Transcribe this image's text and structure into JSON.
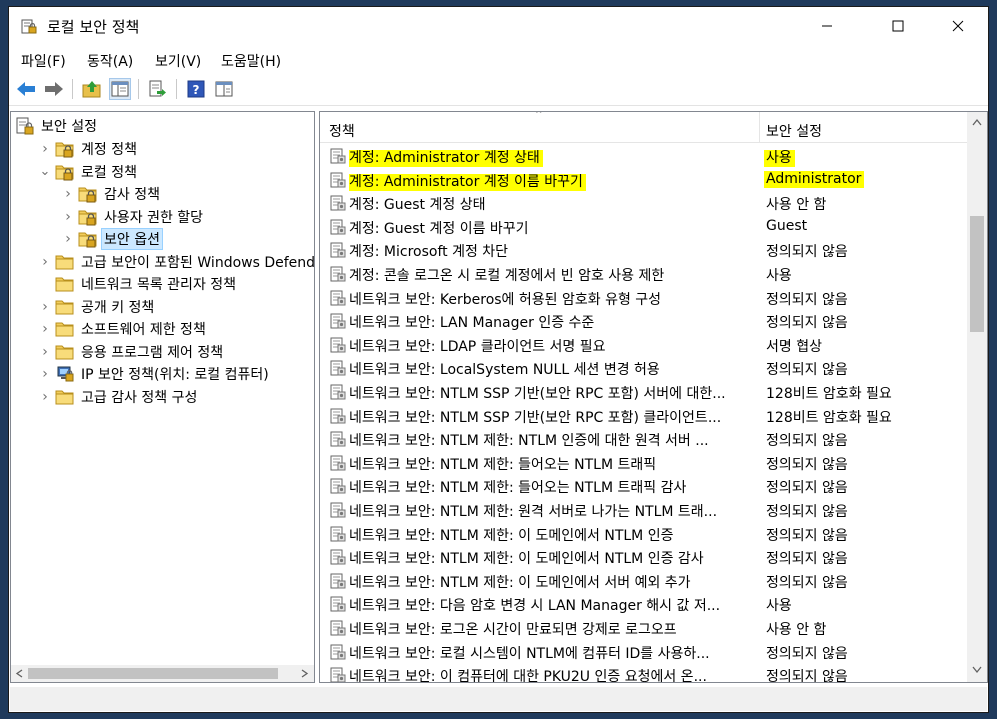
{
  "window": {
    "title": "로컬 보안 정책"
  },
  "menu": [
    "파일(F)",
    "동작(A)",
    "보기(V)",
    "도움말(H)"
  ],
  "toolbar": {
    "buttons": [
      "back-icon",
      "forward-icon",
      "up-folder-icon",
      "show-hide-tree-icon",
      "export-list-icon",
      "help-icon",
      "properties-icon"
    ]
  },
  "tree": {
    "root": "보안 설정",
    "nodes": [
      {
        "label": "계정 정책",
        "indent": 1,
        "expanded": false,
        "icon": "lock-folder-icon"
      },
      {
        "label": "로컬 정책",
        "indent": 1,
        "expanded": true,
        "icon": "lock-folder-icon"
      },
      {
        "label": "감사 정책",
        "indent": 2,
        "expanded": false,
        "icon": "lock-folder-icon"
      },
      {
        "label": "사용자 권한 할당",
        "indent": 2,
        "expanded": false,
        "icon": "lock-folder-icon"
      },
      {
        "label": "보안 옵션",
        "indent": 2,
        "expanded": false,
        "icon": "lock-folder-icon",
        "selected": true
      },
      {
        "label": "고급 보안이 포함된 Windows Defende",
        "indent": 1,
        "expanded": false,
        "icon": "folder-icon"
      },
      {
        "label": "네트워크 목록 관리자 정책",
        "indent": 1,
        "expanded": null,
        "icon": "folder-icon"
      },
      {
        "label": "공개 키 정책",
        "indent": 1,
        "expanded": false,
        "icon": "folder-icon"
      },
      {
        "label": "소프트웨어 제한 정책",
        "indent": 1,
        "expanded": false,
        "icon": "folder-icon"
      },
      {
        "label": "응용 프로그램 제어 정책",
        "indent": 1,
        "expanded": false,
        "icon": "folder-icon"
      },
      {
        "label": "IP 보안 정책(위치: 로컬 컴퓨터)",
        "indent": 1,
        "expanded": false,
        "icon": "ip-security-icon"
      },
      {
        "label": "고급 감사 정책 구성",
        "indent": 1,
        "expanded": false,
        "icon": "folder-icon"
      }
    ]
  },
  "list": {
    "columns": {
      "policy": "정책",
      "setting": "보안 설정"
    },
    "rows": [
      {
        "policy": "계정: Administrator 계정 상태",
        "setting": "사용",
        "highlight": true
      },
      {
        "policy": "계정: Administrator 계정 이름 바꾸기",
        "setting": "Administrator",
        "highlight": true
      },
      {
        "policy": "계정: Guest 계정 상태",
        "setting": "사용 안 함"
      },
      {
        "policy": "계정: Guest 계정 이름 바꾸기",
        "setting": "Guest"
      },
      {
        "policy": "계정: Microsoft 계정 차단",
        "setting": "정의되지 않음"
      },
      {
        "policy": "계정: 콘솔 로그온 시 로컬 계정에서 빈 암호 사용 제한",
        "setting": "사용"
      },
      {
        "policy": "네트워크 보안: Kerberos에 허용된 암호화 유형 구성",
        "setting": "정의되지 않음"
      },
      {
        "policy": "네트워크 보안: LAN Manager 인증 수준",
        "setting": "정의되지 않음"
      },
      {
        "policy": "네트워크 보안: LDAP 클라이언트 서명 필요",
        "setting": "서명 협상"
      },
      {
        "policy": "네트워크 보안: LocalSystem NULL 세션 변경 허용",
        "setting": "정의되지 않음"
      },
      {
        "policy": "네트워크 보안: NTLM SSP 기반(보안 RPC 포함) 서버에 대한...",
        "setting": "128비트 암호화 필요"
      },
      {
        "policy": "네트워크 보안: NTLM SSP 기반(보안 RPC 포함) 클라이언트...",
        "setting": "128비트 암호화 필요"
      },
      {
        "policy": "네트워크 보안: NTLM 제한: NTLM 인증에 대한 원격 서버 ...",
        "setting": "정의되지 않음"
      },
      {
        "policy": "네트워크 보안: NTLM 제한: 들어오는 NTLM 트래픽",
        "setting": "정의되지 않음"
      },
      {
        "policy": "네트워크 보안: NTLM 제한: 들어오는 NTLM 트래픽 감사",
        "setting": "정의되지 않음"
      },
      {
        "policy": "네트워크 보안: NTLM 제한: 원격 서버로 나가는 NTLM 트래...",
        "setting": "정의되지 않음"
      },
      {
        "policy": "네트워크 보안: NTLM 제한: 이 도메인에서 NTLM 인증",
        "setting": "정의되지 않음"
      },
      {
        "policy": "네트워크 보안: NTLM 제한: 이 도메인에서 NTLM 인증 감사",
        "setting": "정의되지 않음"
      },
      {
        "policy": "네트워크 보안: NTLM 제한: 이 도메인에서 서버 예외 추가",
        "setting": "정의되지 않음"
      },
      {
        "policy": "네트워크 보안: 다음 암호 변경 시 LAN Manager 해시 값 저...",
        "setting": "사용"
      },
      {
        "policy": "네트워크 보안: 로그온 시간이 만료되면 강제로 로그오프",
        "setting": "사용 안 함"
      },
      {
        "policy": "네트워크 보안: 로컬 시스템이 NTLM에 컴퓨터 ID를 사용하...",
        "setting": "정의되지 않음"
      },
      {
        "policy": "네트워크 보안: 이 컴퓨터에 대한 PKU2U 인증 요청에서 온...",
        "setting": "정의되지 않음"
      }
    ]
  },
  "colors": {
    "highlight": "#ffff00",
    "selection": "#cce8ff"
  }
}
